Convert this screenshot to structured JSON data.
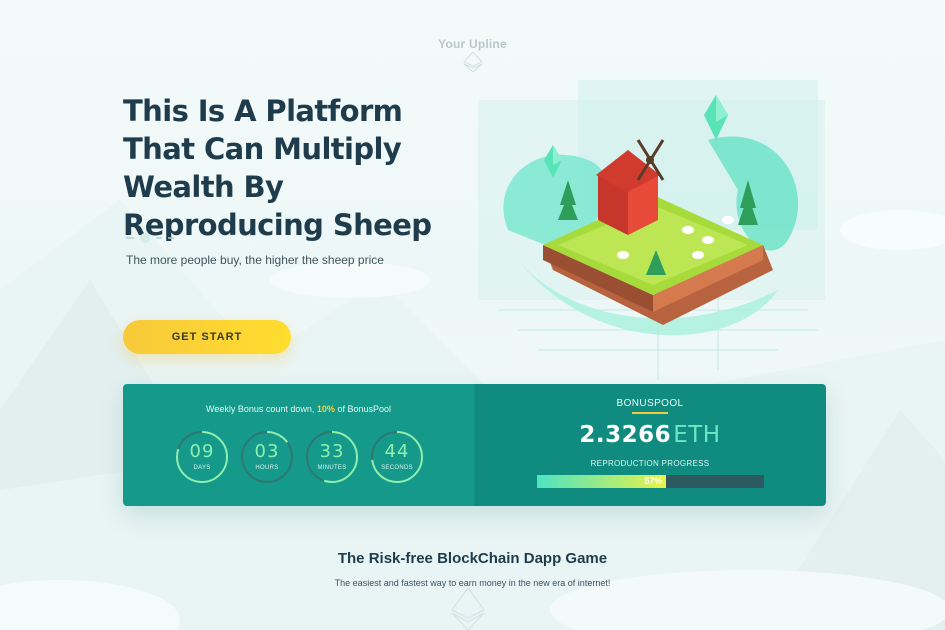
{
  "header": {
    "upline_label": "Your Upline"
  },
  "hero": {
    "title": "This Is A Platform That Can Multiply Wealth By Reproducing Sheep",
    "subtitle": "The more people buy, the higher the sheep price",
    "cta_label": "GET START"
  },
  "countdown": {
    "title_prefix": "Weekly Bonus count down, ",
    "title_percent": "10%",
    "title_suffix": " of BonusPool",
    "timers": [
      {
        "value": "09",
        "unit": "DAYS",
        "fraction": 0.8
      },
      {
        "value": "03",
        "unit": "HOURS",
        "fraction": 0.15
      },
      {
        "value": "33",
        "unit": "MINUTES",
        "fraction": 0.55
      },
      {
        "value": "44",
        "unit": "SECONDS",
        "fraction": 0.73
      }
    ]
  },
  "bonuspool": {
    "title": "BONUSPOOL",
    "amount": "2.3266",
    "currency": "ETH",
    "progress_label": "REPRODUCTION PROGRESS",
    "progress_text": "57%",
    "progress_value": 0.57
  },
  "section": {
    "title_prefix": "The ",
    "title_bold": "Risk-free",
    "title_suffix": " BlockChain Dapp Game",
    "subtitle": "The easiest and fastest way to earn money in the new era of internet!"
  },
  "colors": {
    "accent_yellow": "#ffd23a",
    "panel_teal": "#14998a",
    "panel_teal_dark": "#0f8b80",
    "timer_green": "#8ff0ae"
  }
}
